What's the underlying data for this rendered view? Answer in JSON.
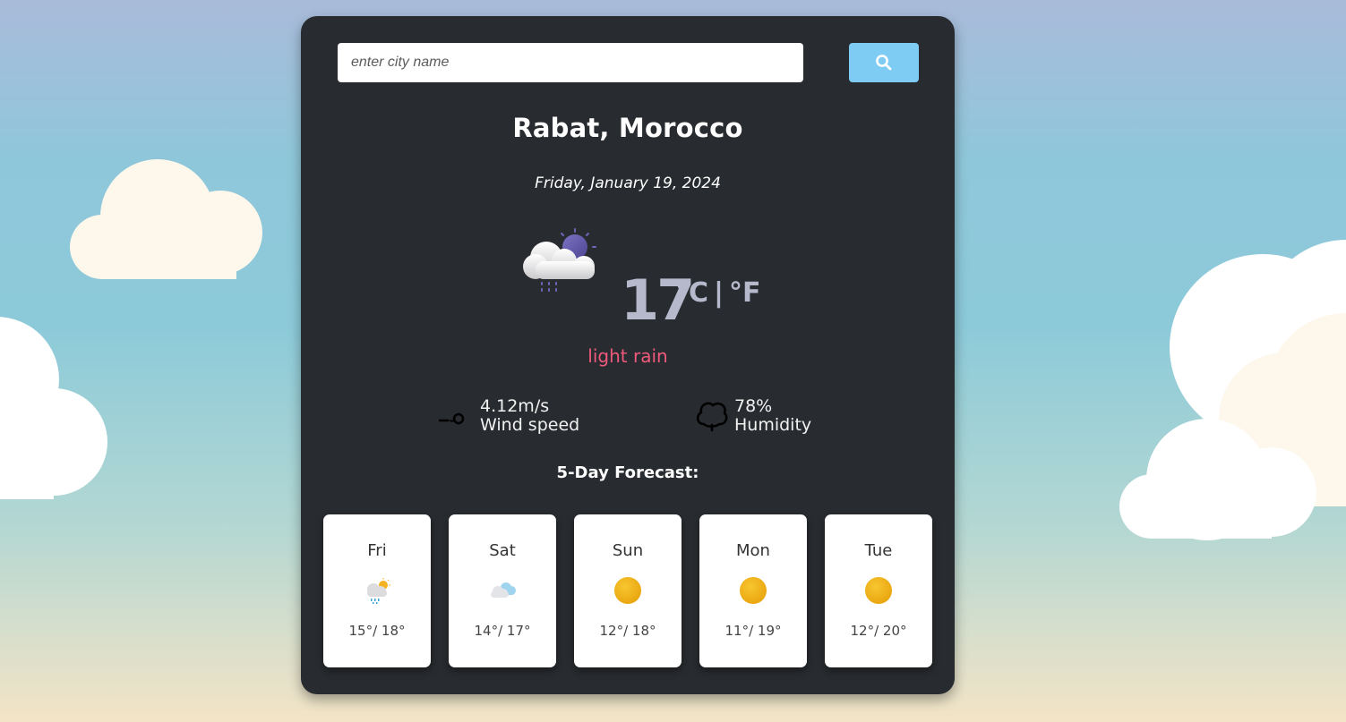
{
  "search": {
    "placeholder": "enter city name",
    "value": ""
  },
  "search_button_icon": "search-icon",
  "location": {
    "city": "Rabat, Morocco",
    "date": "Friday, January 19, 2024"
  },
  "current": {
    "icon": "light-rain-night-icon",
    "temperature": "17",
    "unit_c": "°C",
    "separator": "|",
    "unit_f": "°F",
    "description": "light rain"
  },
  "stats": {
    "wind": {
      "icon": "wind-icon",
      "value": "4.12m/s",
      "label": "Wind speed"
    },
    "humidity": {
      "icon": "humidity-icon",
      "value": "78%",
      "label": "Humidity"
    }
  },
  "forecast_title": "5-Day Forecast:",
  "forecast": [
    {
      "day": "Fri",
      "icon": "rain-sun-icon",
      "temp": "15°/ 18°"
    },
    {
      "day": "Sat",
      "icon": "cloud-icon",
      "temp": "14°/ 17°"
    },
    {
      "day": "Sun",
      "icon": "sun-icon",
      "temp": "12°/ 18°"
    },
    {
      "day": "Mon",
      "icon": "sun-icon",
      "temp": "11°/ 19°"
    },
    {
      "day": "Tue",
      "icon": "sun-icon",
      "temp": "12°/ 20°"
    }
  ],
  "colors": {
    "card": "#282b2f",
    "search_button": "#7ecbf3",
    "temperature": "#b6b8cb",
    "description": "#ef5a7c"
  }
}
